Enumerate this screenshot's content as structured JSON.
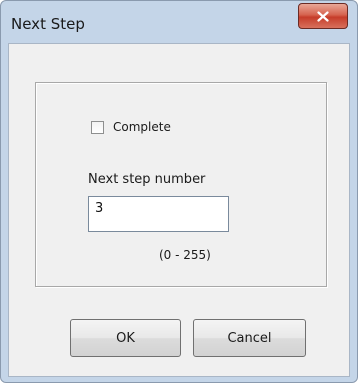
{
  "window": {
    "title": "Next Step"
  },
  "options": {
    "complete_label": "Complete",
    "complete_checked": false
  },
  "step_field": {
    "label": "Next step number",
    "value": "3",
    "range_hint": "(0 - 255)"
  },
  "buttons": {
    "ok_label": "OK",
    "cancel_label": "Cancel"
  },
  "colors": {
    "titlebar": "#c4d5e8",
    "close_button": "#c63d2a",
    "client_background": "#f0f0f0"
  }
}
